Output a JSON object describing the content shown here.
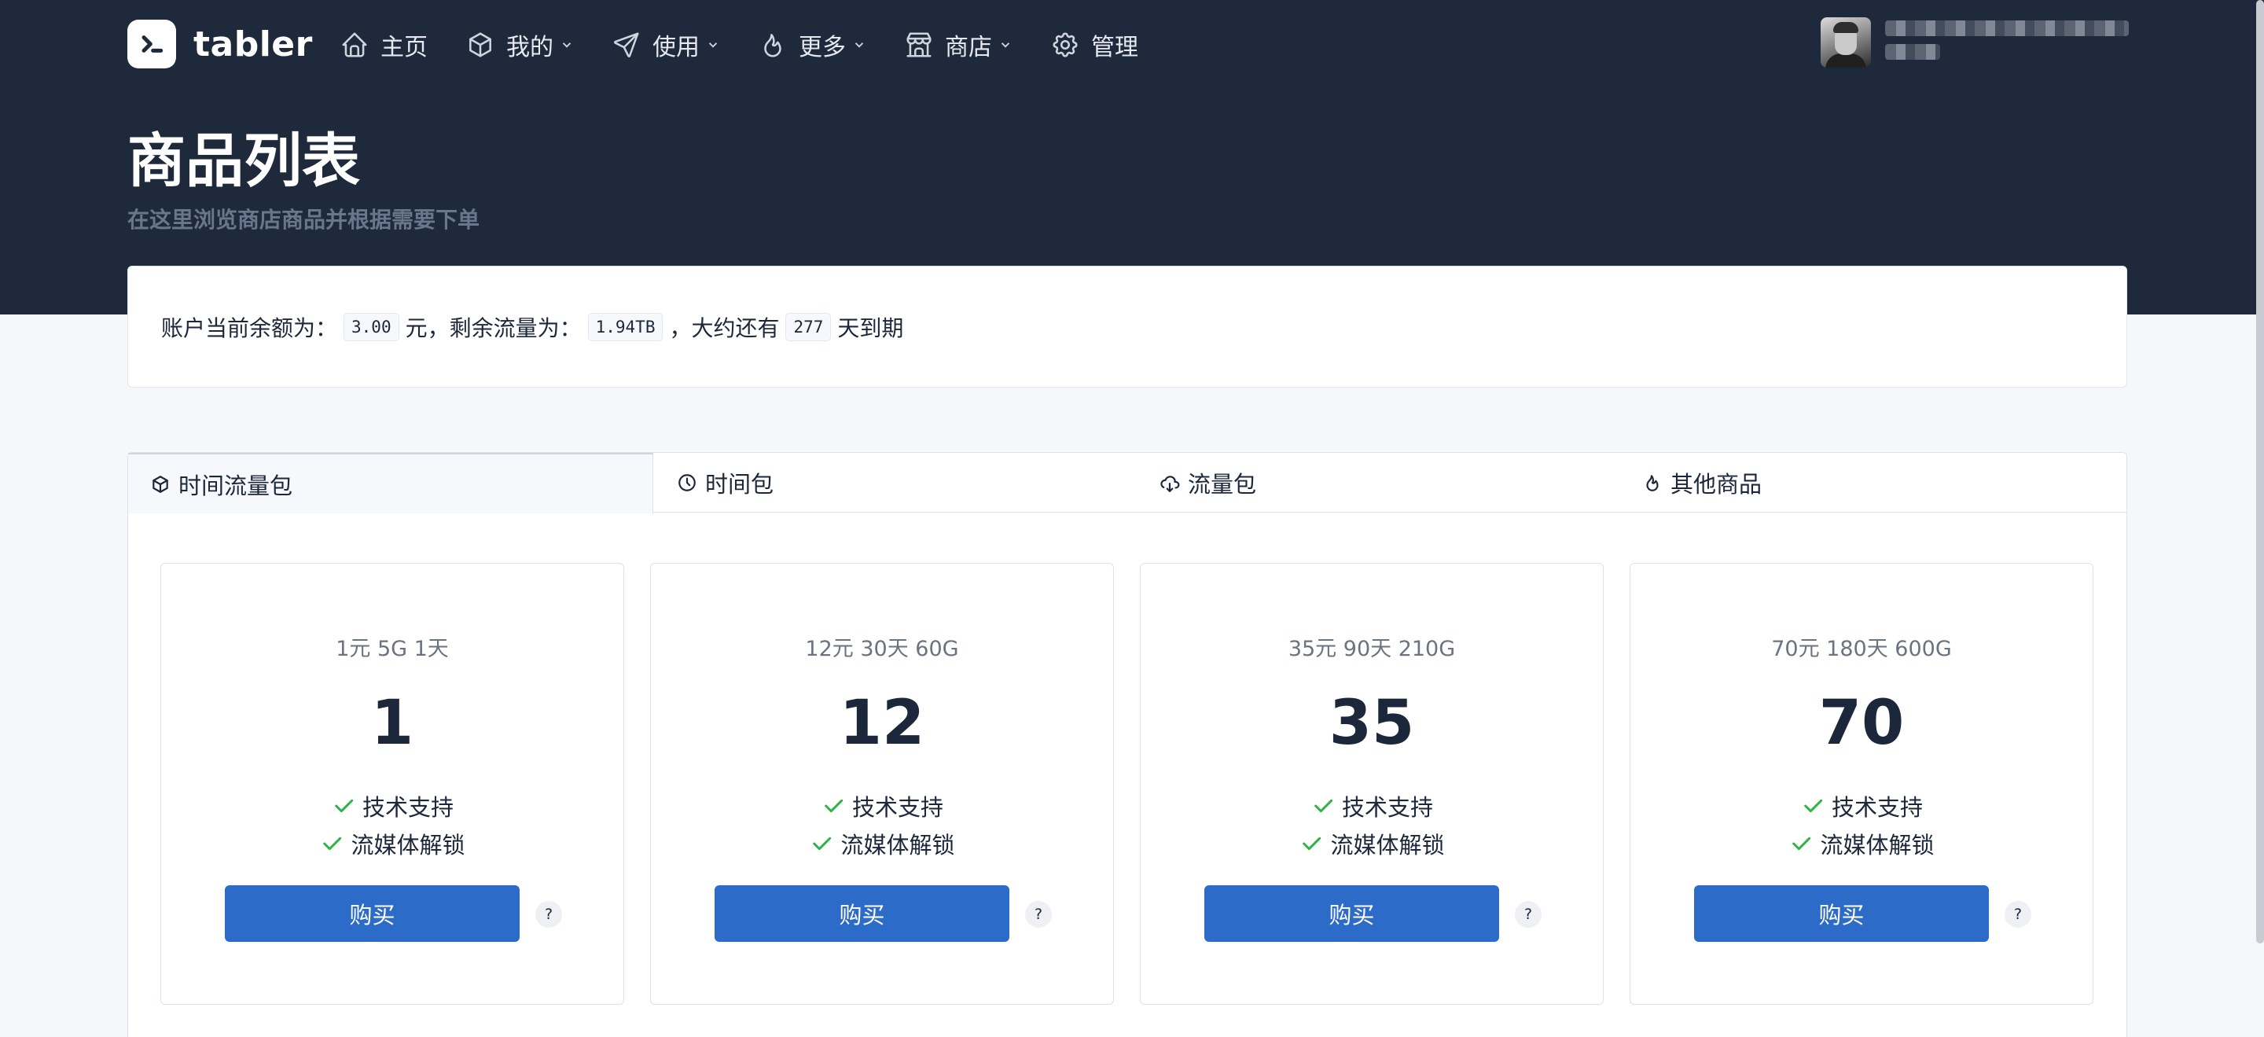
{
  "navbar": {
    "brand": "tabler",
    "items": [
      {
        "label": "主页",
        "icon": "home-icon",
        "dropdown": false
      },
      {
        "label": "我的",
        "icon": "package-icon",
        "dropdown": true
      },
      {
        "label": "使用",
        "icon": "send-icon",
        "dropdown": true
      },
      {
        "label": "更多",
        "icon": "flame-icon",
        "dropdown": true
      },
      {
        "label": "商店",
        "icon": "store-icon",
        "dropdown": true
      },
      {
        "label": "管理",
        "icon": "settings-icon",
        "dropdown": false
      }
    ]
  },
  "page": {
    "title": "商品列表",
    "subtitle": "在这里浏览商店商品并根据需要下单"
  },
  "account": {
    "balance_prefix": "账户当前余额为：",
    "balance": "3.00",
    "balance_suffix": "元，剩余流量为：",
    "traffic": "1.94TB",
    "traffic_suffix": "，大约还有",
    "days": "277",
    "days_suffix": "天到期"
  },
  "tabs": [
    {
      "label": "时间流量包",
      "icon": "package-icon",
      "active": true
    },
    {
      "label": "时间包",
      "icon": "clock-icon",
      "active": false
    },
    {
      "label": "流量包",
      "icon": "cloud-download-icon",
      "active": false
    },
    {
      "label": "其他商品",
      "icon": "flame-icon",
      "active": false
    }
  ],
  "products": [
    {
      "name": "1元 5G 1天",
      "price": "1",
      "features": [
        "技术支持",
        "流媒体解锁"
      ],
      "buy_label": "购买",
      "help_label": "?"
    },
    {
      "name": "12元 30天 60G",
      "price": "12",
      "features": [
        "技术支持",
        "流媒体解锁"
      ],
      "buy_label": "购买",
      "help_label": "?"
    },
    {
      "name": "35元 90天 210G",
      "price": "35",
      "features": [
        "技术支持",
        "流媒体解锁"
      ],
      "buy_label": "购买",
      "help_label": "?"
    },
    {
      "name": "70元 180天 600G",
      "price": "70",
      "features": [
        "技术支持",
        "流媒体解锁"
      ],
      "buy_label": "购买",
      "help_label": "?"
    }
  ],
  "colors": {
    "header_bg": "#1e293b",
    "primary": "#2d6bc8",
    "check": "#2fb344"
  }
}
